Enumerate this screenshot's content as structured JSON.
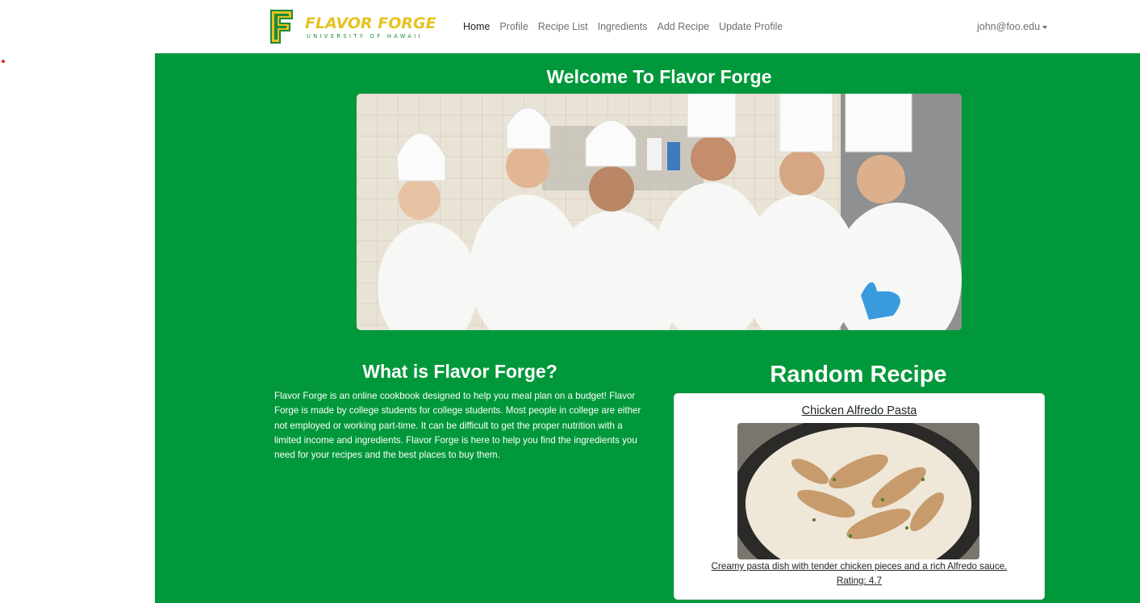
{
  "brand": {
    "logo_text": "FLAVOR FORGE",
    "logo_subtext": "UNIVERSITY OF HAWAII"
  },
  "nav": {
    "items": [
      {
        "label": "Home",
        "active": true
      },
      {
        "label": "Profile"
      },
      {
        "label": "Recipe List"
      },
      {
        "label": "Ingredients"
      },
      {
        "label": "Add Recipe"
      },
      {
        "label": "Update Profile"
      }
    ],
    "user_email": "john@foo.edu"
  },
  "hero": {
    "title": "Welcome To Flavor Forge"
  },
  "about": {
    "title": "What is Flavor Forge?",
    "text": "Flavor Forge is an online cookbook designed to help you meal plan on a budget! Flavor Forge is made by college students for college students. Most people in college are either not employed or working part-time. It can be difficult to get the proper nutrition with a limited income and ingredients. Flavor Forge is here to help you find the ingredients you need for your recipes and the best places to buy them."
  },
  "random_recipe": {
    "heading": "Random Recipe",
    "name": "Chicken Alfredo Pasta",
    "description": "Creamy pasta dish with tender chicken pieces and a rich Alfredo sauce.",
    "rating_text": "Rating: 4.7"
  },
  "colors": {
    "brand_green": "#00983a",
    "logo_yellow": "#e6c220",
    "logo_green": "#1c8a3a"
  }
}
